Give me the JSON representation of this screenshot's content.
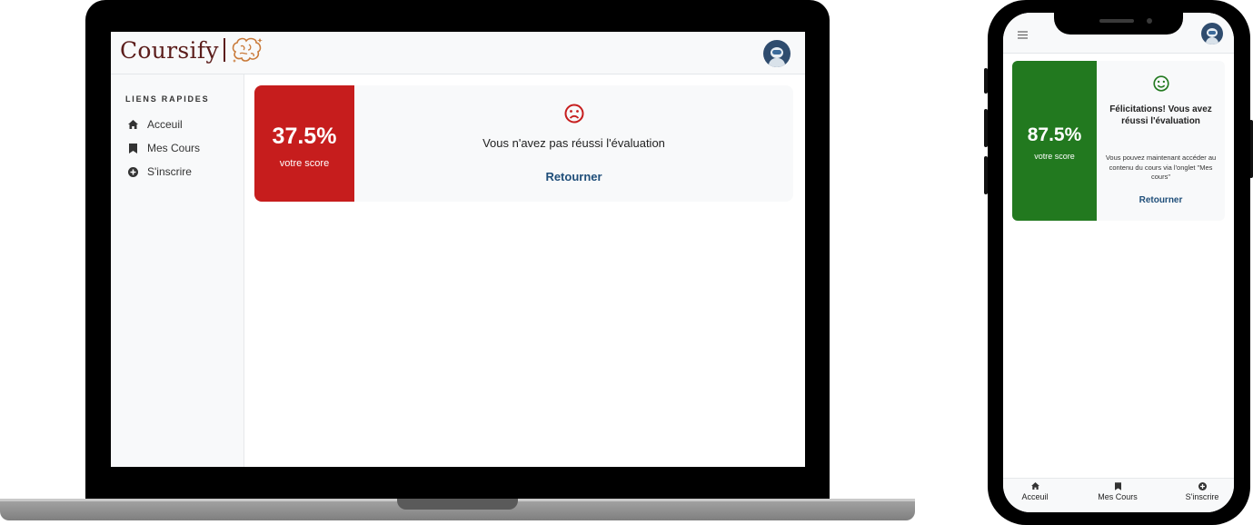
{
  "app": {
    "name": "Coursify"
  },
  "laptop": {
    "sidebar": {
      "title": "LIENS RAPIDES",
      "items": [
        {
          "label": "Acceuil",
          "icon": "home-icon"
        },
        {
          "label": "Mes Cours",
          "icon": "bookmark-icon"
        },
        {
          "label": "S'inscrire",
          "icon": "plus-circle-icon"
        }
      ]
    },
    "result": {
      "score": "37.5%",
      "score_label": "votre score",
      "status_icon": "sad-face-icon",
      "message": "Vous n'avez pas réussi l'évaluation",
      "link": "Retourner"
    }
  },
  "phone": {
    "result": {
      "score": "87.5%",
      "score_label": "votre score",
      "status_icon": "smile-face-icon",
      "title": "Félicitations! Vous avez réussi l'évaluation",
      "message": "Vous pouvez maintenant accéder au contenu du cours via l'onglet \"Mes cours\"",
      "link": "Retourner"
    },
    "bottom_nav": [
      {
        "label": "Acceuil",
        "icon": "home-icon"
      },
      {
        "label": "Mes Cours",
        "icon": "bookmark-icon"
      },
      {
        "label": "S'inscrire",
        "icon": "plus-circle-icon"
      }
    ]
  },
  "colors": {
    "brand": "#5b1d1b",
    "fail": "#c61d1d",
    "success": "#22791f",
    "link": "#1f4e79"
  }
}
